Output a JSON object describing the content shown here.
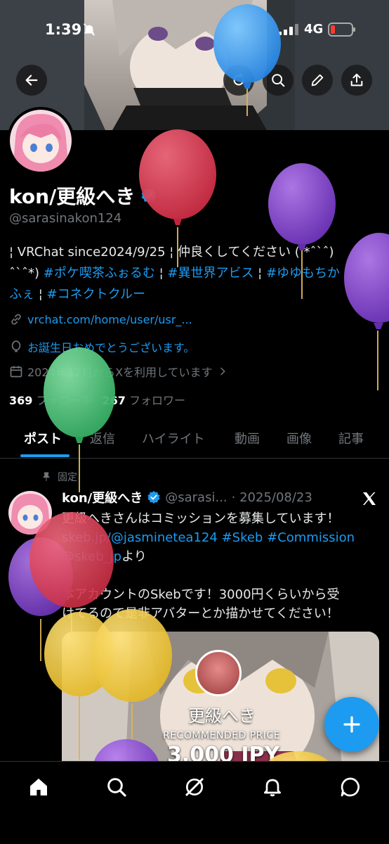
{
  "status_bar": {
    "time": "1:39",
    "network": "4G"
  },
  "profile": {
    "display_name": "kon/更級へき",
    "handle": "@sarasinakon124",
    "bio_line1": "¦ VRChat since2024/9/25 ¦ 仲良くしてください ( *ˆ`ˆ)",
    "bio_line2_pre": "ˆ`ˆ*) ",
    "bio_tag1": "#ポケ喫茶ふぉるむ",
    "bio_sep1": " ¦ ",
    "bio_tag2": "#異世界アビス",
    "bio_sep2": " ¦ ",
    "bio_tag3": "#ゆゆもちか",
    "bio_line3_tag": "ふぇ",
    "bio_sep3": " ¦ ",
    "bio_tag4": "#コネクトクルー",
    "link": "vrchat.com/home/user/usr_...",
    "birthday": "お誕生日おめでとうございます。",
    "joined": "2024年12月からXを利用しています",
    "following_count": "369",
    "following_label": "フォロー中",
    "followers_count": "267",
    "followers_label": "フォロワー"
  },
  "tabs": [
    "ポスト",
    "返信",
    "ハイライト",
    "動画",
    "画像",
    "記事"
  ],
  "post": {
    "pinned_label": "固定",
    "name": "kon/更級へき",
    "handle": "@sarasi...",
    "date": "· 2025/08/23",
    "line1": "更級へきさんはコミッションを募集しています！",
    "link1": "skeb.jp/@jasminetea124",
    "tag1": "#Skeb",
    "tag2": "#Commission",
    "mention": "@skeb_jp",
    "mention_suffix": "より",
    "line3": "本アカウントのSkebです！3000円くらいから受",
    "line4": "けてるので是非アバターとか描かせてください！",
    "media_name": "更級へき",
    "media_rec": "RECOMMENDED PRICE",
    "media_price": "3,000 JPY"
  },
  "colors": {
    "accent": "#1d9bf0",
    "muted": "#71767b",
    "text": "#e7e9ea"
  },
  "icons": [
    "back-arrow-icon",
    "refresh-icon",
    "search-icon",
    "edit-icon",
    "share-icon",
    "home-icon",
    "search-icon",
    "grok-icon",
    "bell-icon",
    "messages-icon"
  ]
}
